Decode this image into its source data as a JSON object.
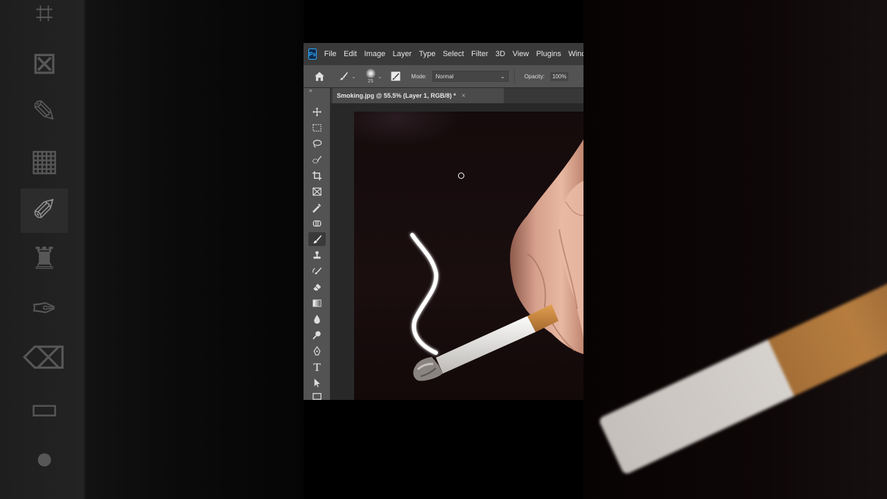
{
  "app": "Photoshop",
  "menubar": {
    "logo": "Ps",
    "items": [
      "File",
      "Edit",
      "Image",
      "Layer",
      "Type",
      "Select",
      "Filter",
      "3D",
      "View",
      "Plugins",
      "Winc"
    ]
  },
  "options_bar": {
    "brush_size": "25",
    "mode_label": "Mode:",
    "mode_value": "Normal",
    "opacity_label": "Opacity:",
    "opacity_value": "100%"
  },
  "document": {
    "tab_title": "Smoking.jpg @ 55.5% (Layer 1, RGB/8) *",
    "close_glyph": "×"
  },
  "toolbar": {
    "collapse_glyph": "»",
    "tools": [
      "move-tool",
      "rectangular-marquee-tool",
      "lasso-tool",
      "quick-selection-tool",
      "crop-tool",
      "frame-tool",
      "eyedropper-tool",
      "spot-healing-tool",
      "brush-tool",
      "clone-stamp-tool",
      "history-brush-tool",
      "eraser-tool",
      "gradient-tool",
      "blur-tool",
      "dodge-tool",
      "pen-tool",
      "type-tool",
      "path-selection-tool",
      "rectangle-tool"
    ],
    "active_tool": "brush-tool"
  },
  "colors": {
    "accent": "#31a8ff",
    "panel": "#535353",
    "menubar": "#3a3a3a",
    "canvas_bg": "#282828"
  }
}
